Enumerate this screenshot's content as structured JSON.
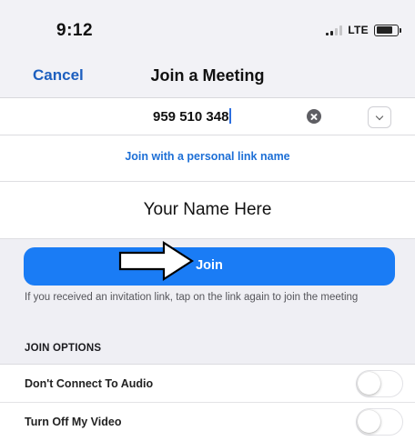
{
  "status_bar": {
    "time": "9:12",
    "network": "LTE",
    "icons": [
      "signal-icon",
      "battery-icon"
    ]
  },
  "nav": {
    "cancel_label": "Cancel",
    "title": "Join a Meeting"
  },
  "meeting_id_field": {
    "value": "959 510 348",
    "clear_icon": "clear-icon",
    "dropdown_icon": "chevron-down-icon"
  },
  "personal_link": {
    "label": "Join with a personal link name"
  },
  "name_field": {
    "value": "Your Name Here"
  },
  "join_button": {
    "label": "Join",
    "annotation_icon": "arrow-icon",
    "color": "#1a7cf5"
  },
  "hint_text": "If you received an invitation link, tap on the link again to join the meeting",
  "join_options": {
    "header": "JOIN OPTIONS",
    "items": [
      {
        "label": "Don't Connect To Audio",
        "enabled": false
      },
      {
        "label": "Turn Off My Video",
        "enabled": false
      }
    ]
  },
  "colors": {
    "accent": "#1d5fbf",
    "background": "#efeff4"
  }
}
